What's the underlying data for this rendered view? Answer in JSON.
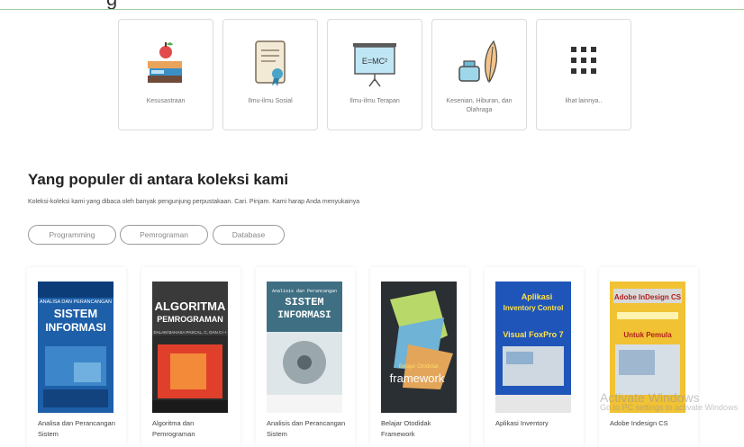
{
  "header": {
    "fragment": "g"
  },
  "categories": [
    {
      "label": "Kesusastraan",
      "icon": "books-apple-icon"
    },
    {
      "label": "Ilmu-ilmu Sosial",
      "icon": "certificate-scroll-icon"
    },
    {
      "label": "Ilmu-ilmu Terapan",
      "icon": "whiteboard-formula-icon"
    },
    {
      "label": "Kesenian, Hiburan, dan Olahraga",
      "icon": "ink-quill-icon"
    },
    {
      "label": "lihat lainnya..",
      "icon": "grid-dots-icon"
    }
  ],
  "whiteboard_text": "E=MC²",
  "section": {
    "title": "Yang populer di antara koleksi kami",
    "description": "Koleksi-koleksi kami yang dibaca oleh banyak pengunjung perpustakaan. Cari. Pinjam. Kami harap Anda menyukainya"
  },
  "tags": [
    "Programming",
    "Pemrograman",
    "Database"
  ],
  "books": [
    {
      "title": "Analisa dan Perancangan Sistem",
      "cover": {
        "lines": [
          "ANALISA DAN PERANCANGAN",
          "SISTEM",
          "INFORMASI"
        ]
      }
    },
    {
      "title": "Algoritma dan Pemrograman",
      "cover": {
        "lines": [
          "ALGORITMA",
          "PEMROGRAMAN",
          "DALAM BAHASA PASCAL, C, DAN C++"
        ]
      }
    },
    {
      "title": "Analisis dan Perancangan Sistem",
      "cover": {
        "lines": [
          "Analisis dan Perancangan",
          "SISTEM",
          "INFORMASI"
        ]
      }
    },
    {
      "title": "Belajar Otodidak Framework",
      "cover": {
        "lines": [
          "Belajar Otodidak",
          "framework"
        ]
      }
    },
    {
      "title": "Aplikasi Inventory",
      "cover": {
        "lines": [
          "Aplikasi",
          "Inventory Control",
          "Visual FoxPro 7"
        ]
      }
    },
    {
      "title": "Adobe Indesign CS",
      "cover": {
        "lines": [
          "Adobe InDesign CS",
          "Untuk Pemula"
        ]
      }
    }
  ],
  "watermark": {
    "line1": "Activate Windows",
    "line2": "Go to PC settings to activate Windows"
  },
  "colors": {
    "card_border": "#dcdcdc",
    "top_rule": "#9fcf9f",
    "pill_border": "#999999"
  }
}
